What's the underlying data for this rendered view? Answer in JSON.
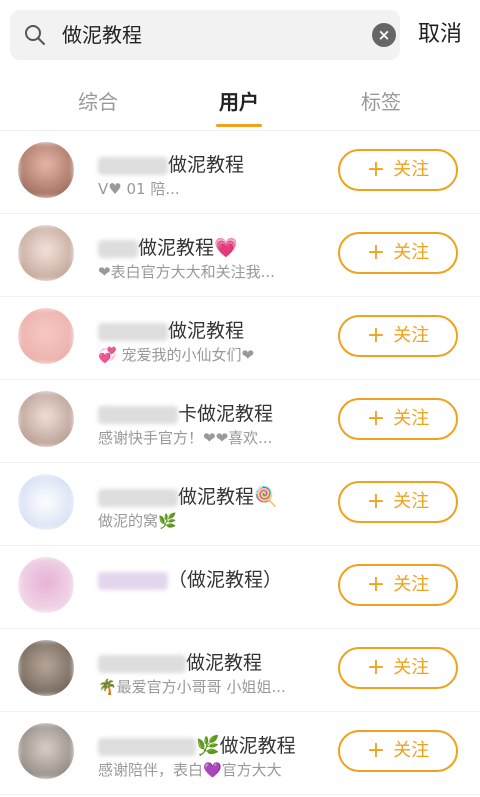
{
  "search": {
    "query": "做泥教程",
    "clear_symbol": "×"
  },
  "cancel_label": "取消",
  "tabs": [
    {
      "label": "综合"
    },
    {
      "label": "用户"
    },
    {
      "label": "标签"
    }
  ],
  "follow_label": "关注",
  "follow_plus": "+",
  "users": [
    {
      "name": "做泥教程",
      "desc": "V♥ 01 陪..."
    },
    {
      "name": "做泥教程💗",
      "desc": "❤表白官方大大和关注我..."
    },
    {
      "name": "做泥教程",
      "desc": "💞 宠爱我的小仙女们❤"
    },
    {
      "name": "卡做泥教程",
      "desc": "感谢快手官方！❤❤喜欢..."
    },
    {
      "name": "做泥教程🍭",
      "desc": "做泥的窝🌿"
    },
    {
      "name": "（做泥教程）",
      "desc": ""
    },
    {
      "name": "做泥教程",
      "desc": "🌴最爱官方小哥哥 小姐姐..."
    },
    {
      "name": "🌿做泥教程",
      "desc": "感谢陪伴，表白💜官方大大"
    }
  ],
  "colors": {
    "accent": "#f0a21c",
    "text": "#333333",
    "muted": "#999999"
  }
}
